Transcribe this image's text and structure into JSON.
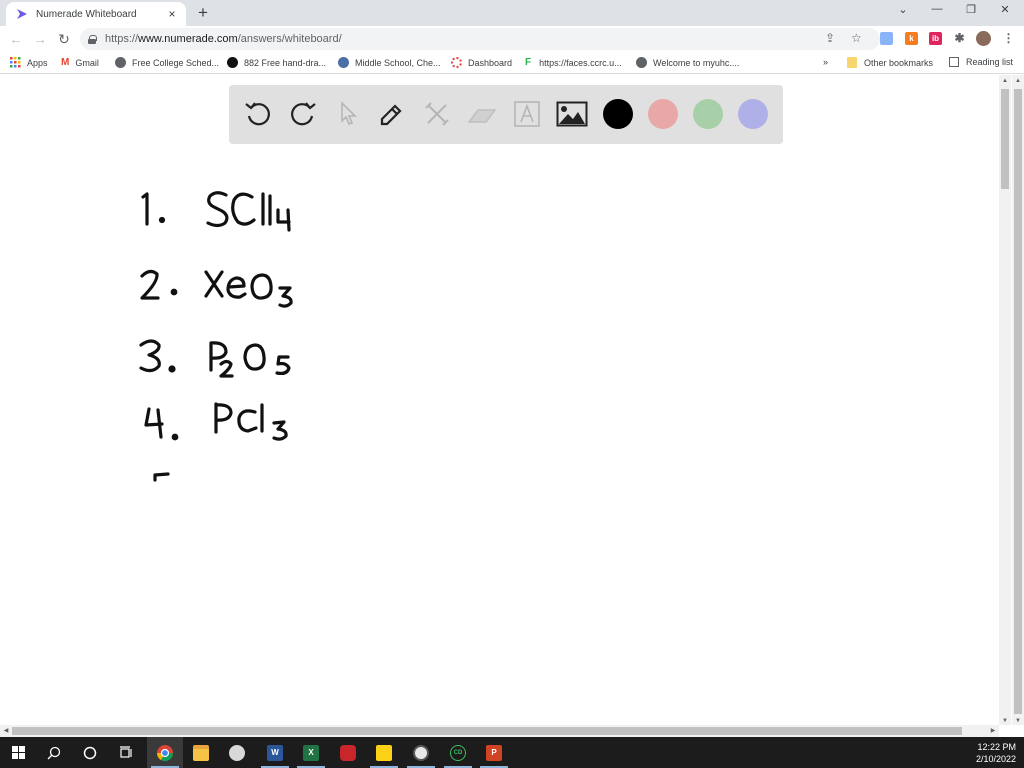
{
  "browser": {
    "tab": {
      "title": "Numerade Whiteboard",
      "close": "×"
    },
    "new_tab": "+",
    "window_controls": {
      "tab_search": "⌄",
      "minimize": "—",
      "restore": "❐",
      "close": "✕"
    },
    "nav": {
      "back": "←",
      "forward": "→",
      "reload": "↻"
    },
    "address": {
      "scheme": "https://",
      "host": "www.numerade.com",
      "path": "/answers/whiteboard/"
    },
    "omnibox_icons": {
      "share": "⇪",
      "star": "☆"
    },
    "extensions": [
      {
        "name": "docs-extension",
        "label": "",
        "color": "#8ab4f8"
      },
      {
        "name": "k-extension",
        "label": "k",
        "color": "#f57c20"
      },
      {
        "name": "ib-extension",
        "label": "ib",
        "color": "#e0245e"
      },
      {
        "name": "puzzle-extension",
        "label": "✱",
        "color": "#5f6368"
      }
    ],
    "menu": "⋮",
    "bookmarks": [
      {
        "label": "Apps",
        "icon": "apps-grid-icon"
      },
      {
        "label": "Gmail",
        "icon": "gmail-icon"
      },
      {
        "label": "Free College Sched...",
        "icon": "globe-icon"
      },
      {
        "label": "882 Free hand-dra...",
        "icon": "site-icon"
      },
      {
        "label": "Middle School, Che...",
        "icon": "site-icon"
      },
      {
        "label": "Dashboard",
        "icon": "dashboard-icon"
      },
      {
        "label": "https://faces.ccrc.u...",
        "icon": "faces-icon"
      },
      {
        "label": "Welcome to myuhc....",
        "icon": "globe-icon"
      }
    ],
    "bookmarks_overflow": "»",
    "other_bookmarks": "Other bookmarks",
    "reading_list": "Reading list"
  },
  "whiteboard": {
    "tools": [
      {
        "name": "undo",
        "enabled": true
      },
      {
        "name": "redo",
        "enabled": true
      },
      {
        "name": "select",
        "enabled": false
      },
      {
        "name": "pen",
        "enabled": true,
        "active": true
      },
      {
        "name": "shapes",
        "enabled": false
      },
      {
        "name": "eraser",
        "enabled": false
      },
      {
        "name": "text",
        "enabled": false
      },
      {
        "name": "image",
        "enabled": true
      }
    ],
    "colors": [
      "#000000",
      "#e8a8a8",
      "#a8d0a8",
      "#b0b0e8"
    ],
    "selected_color": "#000000",
    "handwritten_content": [
      {
        "number": "1.",
        "formula": "SCl",
        "subscript": "4"
      },
      {
        "number": "2.",
        "formula": "XeO",
        "subscript": "3"
      },
      {
        "number": "3.",
        "formula": "P2O5",
        "subscript": ""
      },
      {
        "number": "4.",
        "formula": "PCl",
        "subscript": "3"
      },
      {
        "number": "5 (partial)",
        "formula": "",
        "subscript": ""
      }
    ]
  },
  "taskbar": {
    "apps": [
      {
        "name": "start",
        "label": ""
      },
      {
        "name": "search",
        "label": ""
      },
      {
        "name": "cortana",
        "label": ""
      },
      {
        "name": "task-view",
        "label": ""
      },
      {
        "name": "chrome",
        "label": ""
      },
      {
        "name": "file-explorer",
        "label": ""
      },
      {
        "name": "snipping-tool",
        "label": ""
      },
      {
        "name": "word",
        "label": "W"
      },
      {
        "name": "excel",
        "label": "X"
      },
      {
        "name": "app-red",
        "label": ""
      },
      {
        "name": "sticky-notes",
        "label": ""
      },
      {
        "name": "clock-app",
        "label": ""
      },
      {
        "name": "cd-app",
        "label": "CD"
      },
      {
        "name": "powerpoint",
        "label": "P"
      }
    ],
    "time": "12:22 PM",
    "date": "2/10/2022"
  }
}
